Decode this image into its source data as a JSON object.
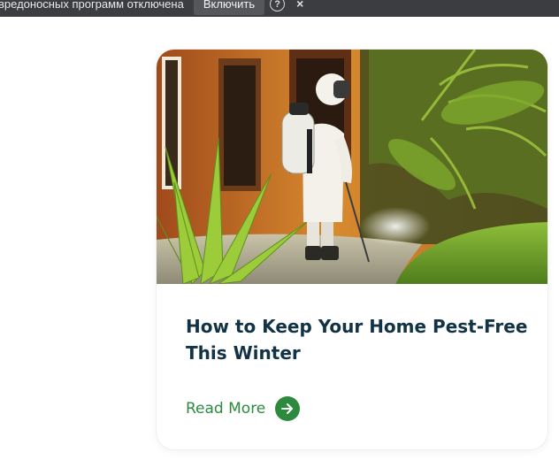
{
  "notification": {
    "text": "вредоносных программ отключена",
    "enable_label": "Включить",
    "help_glyph": "?",
    "close_glyph": "×"
  },
  "card": {
    "image_subject": "pest-control-worker-spraying-garden",
    "title": "How to Keep Your Home Pest-Free This Winter",
    "read_more_label": "Read More",
    "arrow_icon": "arrow-right-icon",
    "accent_color": "#2b8a3e",
    "title_color": "#113345"
  }
}
